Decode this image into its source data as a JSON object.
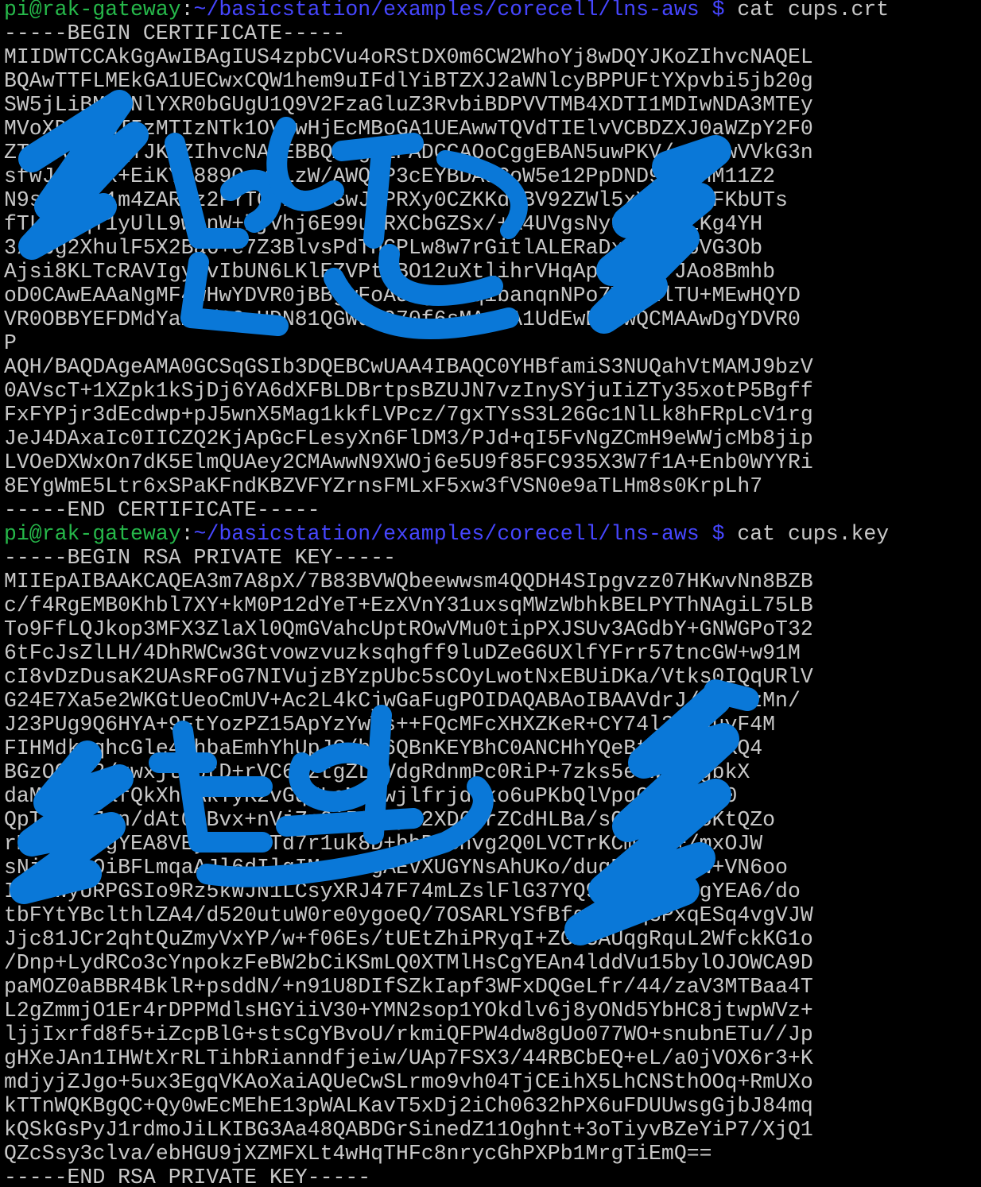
{
  "prompt": {
    "user_host": "pi@rak-gateway",
    "separator": ":",
    "path": "~/basicstation/examples/corecell/lns-aws",
    "dollar": "$"
  },
  "commands": {
    "cat_crt": "cat cups.crt",
    "cat_key": "cat cups.key"
  },
  "certificate": {
    "begin": "-----BEGIN CERTIFICATE-----",
    "lines": [
      "MIIDWTCCAkGgAwIBAgIUS4zpbCVu4oRStDX0m6CW2WhoYj8wDQYJKoZIhvcNAQEL",
      "BQAwTTFLMEkGA1UECwxCQW1hem9uIFdlYiBTZXJ2aWNlcyBPPUFtYXpvbi5jb20g",
      "SW5jLiBMPVNlYXR0bGUgU1Q9V2FzaGluZ3RvbiBDPVVTMB4XDTI1MDIwNDA3MTEy",
      "MVoXDTQ5MTIzMTIzNTk1OVowHjEcMBoGA1UEAwwTQVdTIElvVCBDZXJ0aWZpY2F0",
      "ZTCCASIwDQYJKoZIhvcNAQEBBQADggEPADCCAQoCggEBAN5uwPKV/swfNwVVkG3n",
      "sfwJqZcSx+EiKYE889OxvsLzW/AWQhP3cEYBDAdCoW5e12PpDND9mSjhM11Z2",
      "N9sb7nFs1m4ZARCz2FYTQIIi++SwJ6PRXy0CZKKdzBV92ZWl5xYbMgoXFKbUTs",
      "fTLtwTqT1yUlL9wnnW+hjVhj6E99urRXCbGZSx/+A4UVgsNy9Tm7s5LKg4YH",
      "3/Zbg2XhulF5X2Ba6+e7Z3BlvsPdTHCPLw8w7rGitlALERaDxyXwWM6VG3Ob",
      "Ajsi8KLTcRAVIgymvIbUN6LKlEZVPtuBO12uXtlihrVHqAp2dMNi+JAo8Bmhb",
      "oD0CAwEAAaNgMF4wHwYDVR0jBBgwFoAUXgsL7qibanqnNPo7YGtNlTU+MEwHQYD",
      "VR0OBBYEFDMdYamz/62nUDN81QGWdu970f6sMAwGA1UdEwEB/wQCMAAwDgYDVR0",
      "P",
      "AQH/BAQDAgeAMA0GCSqGSIb3DQEBCwUAA4IBAQC0YHBfamiS3NUQahVtMAMJ9bzV",
      "0AVscT+1XZpk1kSjDj6YA6dXFBLDBrtpsBZUJN7vzInySYjuIiZTy35xotP5Bgff",
      "FxFYPjr3dEcdwp+pJ5wnX5Mag1kkfLVPcz/7gxTYsS3L26Gc1NlLk8hFRpLcV1rg",
      "JeJ4DAxaIc0IICZQ2KjApGcFLesyXn6FlDM3/PJd+qI5FvNgZCmH9eWWjcMb8jip",
      "LVOeDXWxOn7dK5ElmQUAey2CMAwwN9XWOj6e5U9f85FC935X3W7f1A+Enb0WYYRi",
      "8EYgWmE5Ltr6xSPaKFndKBZVFYZrnsFMLxF5xw3fVSN0e9aTLHm8s0KrpLh7"
    ],
    "end": "-----END CERTIFICATE-----"
  },
  "private_key": {
    "begin": "-----BEGIN RSA PRIVATE KEY-----",
    "lines": [
      "MIIEpAIBAAKCAQEA3m7A8pX/7B83BVWQbeewwsm4QQDH4SIpgvzz07HKwvNn8BZB",
      "c/f4RgEMB0Khbl7XY+kM0P12dYeT+EzXVnY31uxsqMWzWbhkBELPYThNAgiL75LB",
      "To9FfLQJkop3MFX3ZlaXl0QmGVahcUptROwVMu0tipPXJSUv3AGdbY+GNWGPoT32",
      "6tFcJsZlLH/4DhRWCw3Gtvowzvuzksqhgff9luDZeG6UXlfYFrr57tncGW+w91M",
      "cI8vDzDusaK2UAsRFoG7NIVujzBYzpUbc5sCOyLwotNxEBUiDKa/Vtks0IQqURlV",
      "G24E7Xa5e2WKGtUeoCmUV+Ac2L4kCjwGaFugPOIDAQABAoIBAAVdrJ/AzG8zMn/",
      "J23PUg9Q6HYA+9FtYozPZ15ApYzYwWs++FQcMFcXHXZKeR+CY74l3rQauyF4M",
      "FIHMdkwqhcGle4LhbaEmhYhUpJC/hU6QBnKEYBhC0ANCHhYQeBtzg9ce0KQ4",
      "BGzOO5K2/uwxjtTbtD+rVC6hztgZLdVdgRdnmPc0RiP+7zks5etWLBAgbkX",
      "daMs6jHdafQkXhdAkTyK2vGqMLoMxVwjlfrjdlko6uPKbQlVpqCgOLstV0",
      "QpTZVCsJvn/dAt0SBvx+nVjZp0i5SbLyW2XD6PrZCdHLBa/sQZ9yYDs5KtQZo",
      "rM4pJc0CgYEA8VEyAbTwMTd7r1uk8D+hbP1Bhvg2Q0LVCTrKCmjqJ+/mxOJW",
      "sNiVhmaOiBFLmqaAJl6dIlgIMrdYbgAEVXUGYNsAhUKo/duqPbjUgUjw+VN6oo",
      "IUYLwyURPGSIo9Rz5kWJN1LCsyXRJ47F74mLZslFlG37YQ9YF+qDkzCgYEA6/do",
      "tbFYtYBclthlZA4/d520utuW0re0ygoeQ/7OSARLYSfBfqx0eSq8PxqESq4vgVJW",
      "Jjc81JCr2qhtQuZmyVxYP/w+f06Es/tUEtZhiPRyqI+ZG23AUqgRquL2WfckKG1o",
      "/Dnp+LydRCo3cYnpokzFeBW2bCiKSmLQ0XTMlHsCgYEAn4lddVu15bylOJOWCA9D",
      "paMOZ0aBBR4BklR+psddN/+n91U8DIfSZkIapf3WFxDQGeLfr/44/zaV3MTBaa4T",
      "L2gZmmjO1Er4rDPPMdlsHGYiiV30+YMN2sop1YOkdlv6j8yONd5YbHC8jtwpWVz+",
      "ljjIxrfd8f5+iZcpBlG+stsCgYBvoU/rkmiQFPW4dw8gUo077WO+snubnETu//Jp",
      "gHXeJAn1IHWtXrRLTihbRianndfjeiw/UAp7FSX3/44RBCbEQ+eL/a0jVOX6r3+K",
      "mdjyjZJgo+5ux3EgqVKAoXaiAQUeCwSLrmo9vh04TjCEihX5LhCNSthOOq+RmUXo",
      "kTTnWQKBgQC+Qy0wEcMEhE13pWALKavT5xDj2iCh0632hPX6uFDUUwsgGjbJ84mq",
      "kQSkGsPyJ1rdmoJiLKIBG3Aa48QABDGrSinedZ11Oghnt+3oTiyvBZeYiP7/XjQ1",
      "QZcSsy3clva/ebHGU9jXZMFXLt4wHqTHFc8nrycGhPXPb1MrgTiEmQ=="
    ],
    "end": "-----END RSA PRIVATE KEY-----"
  },
  "colors": {
    "background": "#000000",
    "text": "#c8c8c8",
    "prompt_user": "#26b84a",
    "prompt_path": "#4646ff",
    "scribble": "#0a78d8"
  }
}
